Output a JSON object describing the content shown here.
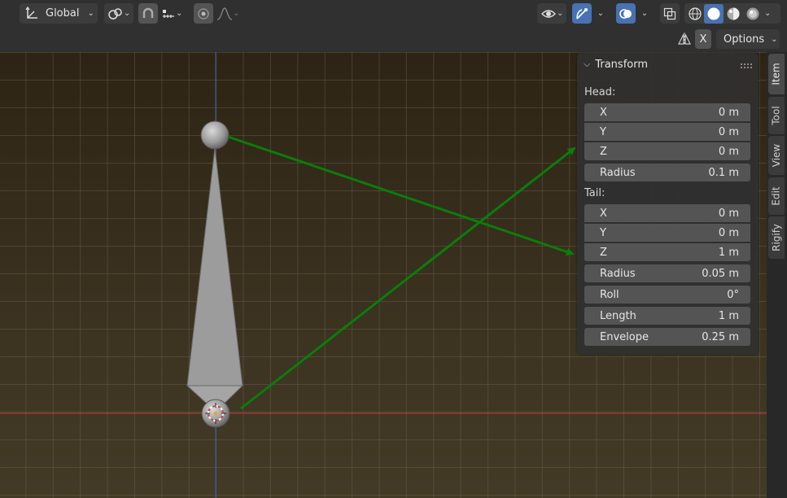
{
  "header": {
    "orientation_label": "Global",
    "icons": [
      "transform-orientation-icon",
      "pivot-point-icon",
      "snap-icon",
      "snap-increment-icon",
      "proportional-editing-icon",
      "falloff-curve-icon",
      "visibility-icon",
      "gizmo-icon",
      "overlays-icon",
      "xray-icon",
      "shading-wireframe-icon",
      "shading-solid-icon",
      "shading-material-icon",
      "shading-rendered-icon"
    ]
  },
  "header2": {
    "axis_label": "X",
    "options_label": "Options"
  },
  "panel": {
    "title": "Transform",
    "head_label": "Head:",
    "tail_label": "Tail:",
    "head": {
      "x": {
        "label": "X",
        "value": "0 m"
      },
      "y": {
        "label": "Y",
        "value": "0 m"
      },
      "z": {
        "label": "Z",
        "value": "0 m"
      },
      "radius": {
        "label": "Radius",
        "value": "0.1 m"
      }
    },
    "tail": {
      "x": {
        "label": "X",
        "value": "0 m"
      },
      "y": {
        "label": "Y",
        "value": "0 m"
      },
      "z": {
        "label": "Z",
        "value": "1 m"
      },
      "radius": {
        "label": "Radius",
        "value": "0.05 m"
      }
    },
    "roll": {
      "label": "Roll",
      "value": "0°"
    },
    "length": {
      "label": "Length",
      "value": "1 m"
    },
    "envelope": {
      "label": "Envelope",
      "value": "0.25 m"
    }
  },
  "tabs": [
    "Item",
    "Tool",
    "View",
    "Edit",
    "Rigify"
  ],
  "colors": {
    "accent": "#4772b3",
    "annotation_arrow": "#0a7d0a",
    "x_axis": "#c23a3a",
    "z_axis": "#3a5fb5"
  }
}
